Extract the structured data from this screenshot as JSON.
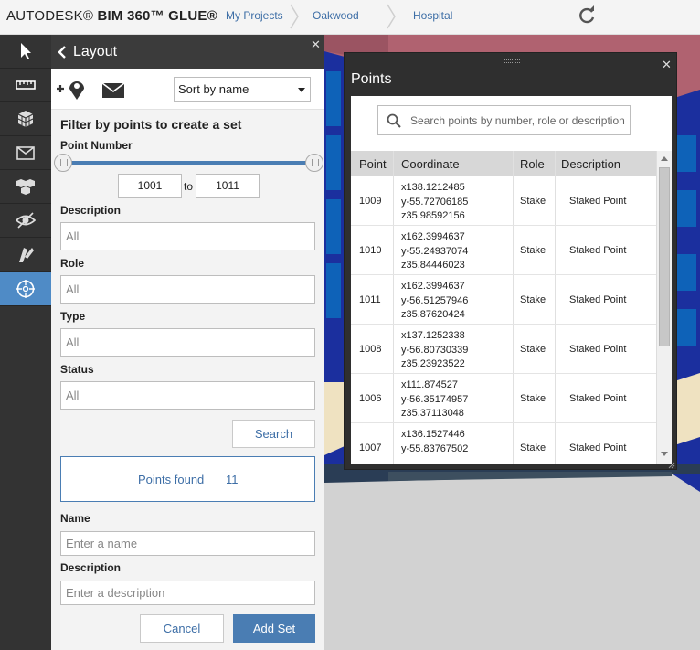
{
  "topbar": {
    "logo_prefix": "AUTODESK®",
    "logo_product": "BIM 360™ GLUE®",
    "breadcrumbs": [
      "My Projects",
      "Oakwood",
      "Hospital"
    ],
    "refresh_icon": "refresh-icon"
  },
  "toolbar": {
    "tools": [
      "select-icon",
      "measure-icon",
      "model-icon",
      "markup-icon",
      "views-icon",
      "visibility-icon",
      "clash-icon",
      "layout-icon"
    ],
    "active_index": 7,
    "active_color": "#4f8bc6"
  },
  "layout_panel": {
    "title": "Layout",
    "sort_label": "Sort by name",
    "filter_title": "Filter by points to create a set",
    "point_number_label": "Point Number",
    "range_from": "1001",
    "range_to_word": "to",
    "range_to": "1011",
    "description_label": "Description",
    "description_value": "All",
    "role_label": "Role",
    "role_value": "All",
    "type_label": "Type",
    "type_value": "All",
    "status_label": "Status",
    "status_value": "All",
    "search_button": "Search",
    "points_found_label": "Points found",
    "points_found_count": "11",
    "name_label": "Name",
    "name_placeholder": "Enter a name",
    "desc2_label": "Description",
    "desc2_placeholder": "Enter a description",
    "cancel_button": "Cancel",
    "add_set_button": "Add Set",
    "accent_color": "#4a7db3"
  },
  "points_window": {
    "title": "Points",
    "search_placeholder": "Search points by number, role or description",
    "columns": [
      "Point",
      "Coordinate",
      "Role",
      "Description"
    ],
    "rows": [
      {
        "point": "1009",
        "x": "x138.1212485",
        "y": "y-55.72706185",
        "z": "z35.98592156",
        "role": "Stake",
        "description": "Staked Point"
      },
      {
        "point": "1010",
        "x": "x162.3994637",
        "y": "y-55.24937074",
        "z": "z35.84446023",
        "role": "Stake",
        "description": "Staked Point"
      },
      {
        "point": "1011",
        "x": "x162.3994637",
        "y": "y-56.51257946",
        "z": "z35.87620424",
        "role": "Stake",
        "description": "Staked Point"
      },
      {
        "point": "1008",
        "x": "x137.1252338",
        "y": "y-56.80730339",
        "z": "z35.23923522",
        "role": "Stake",
        "description": "Staked Point"
      },
      {
        "point": "1006",
        "x": "x111.874527",
        "y": "y-56.35174957",
        "z": "z35.37113048",
        "role": "Stake",
        "description": "Staked Point"
      },
      {
        "point": "1007",
        "x": "x136.1527446",
        "y": "y-55.83767502",
        "z": "",
        "role": "Stake",
        "description": "Staked Point"
      }
    ]
  }
}
